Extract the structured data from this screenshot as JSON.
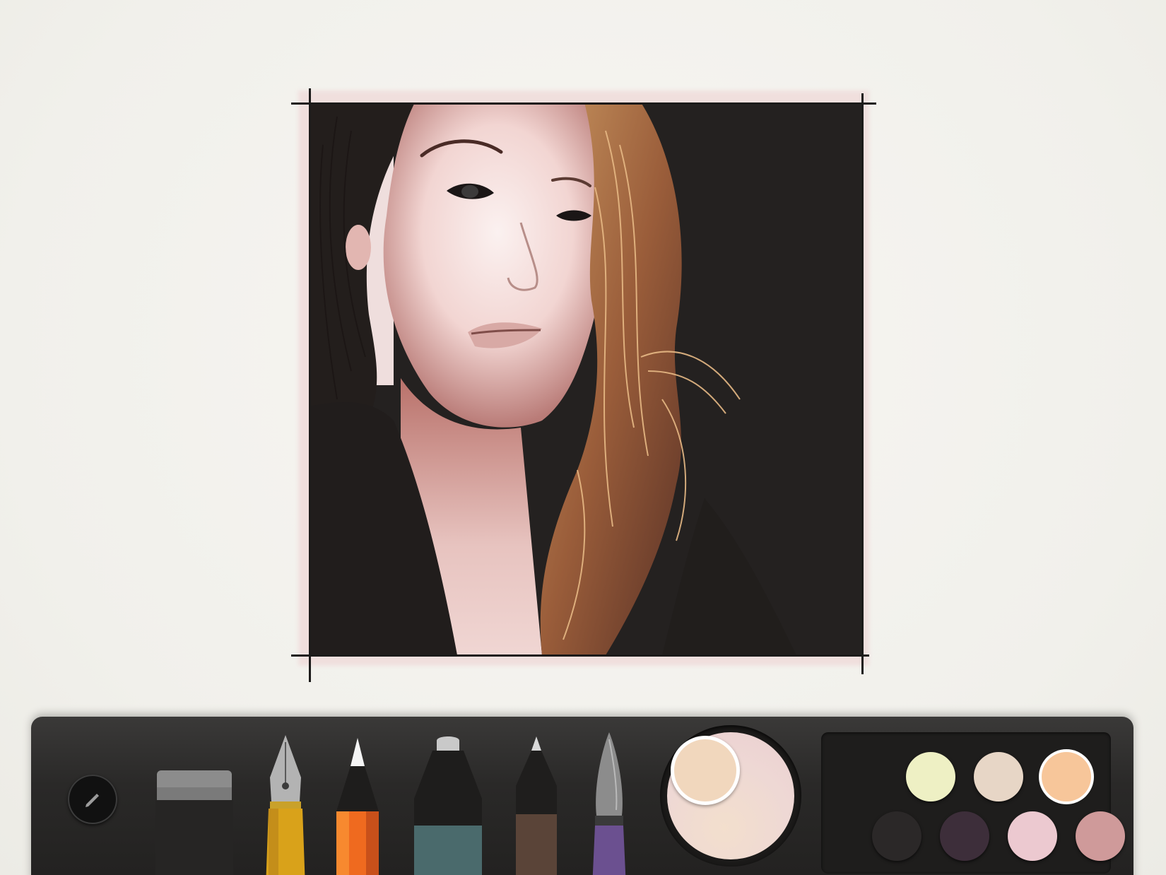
{
  "app": {
    "canvas": {
      "artwork_description": "",
      "backgroundColor": "#f3f2ee"
    },
    "toolbar": {
      "tool_options_icon": "pencil-icon",
      "tools": [
        {
          "id": "eraser",
          "icon": "eraser-icon"
        },
        {
          "id": "fountain-pen",
          "icon": "fountain-pen-icon"
        },
        {
          "id": "pencil",
          "icon": "pencil-icon",
          "selected": true
        },
        {
          "id": "marker",
          "icon": "marker-icon"
        },
        {
          "id": "outline-pen",
          "icon": "pen-icon"
        },
        {
          "id": "watercolor-brush",
          "icon": "brush-icon"
        }
      ],
      "mixer": {
        "current_color": "#f1d7bd",
        "plate_color": "#eed8d4"
      },
      "palette": {
        "swatches": [
          {
            "color": "#eef0c4"
          },
          {
            "color": "#e7d6c6"
          },
          {
            "color": "#f7c69a",
            "selected": true
          },
          {
            "color": "#2b2828"
          },
          {
            "color": "#3d2e3a"
          },
          {
            "color": "#ecc9d0"
          },
          {
            "color": "#cf9a9a"
          }
        ]
      }
    }
  }
}
